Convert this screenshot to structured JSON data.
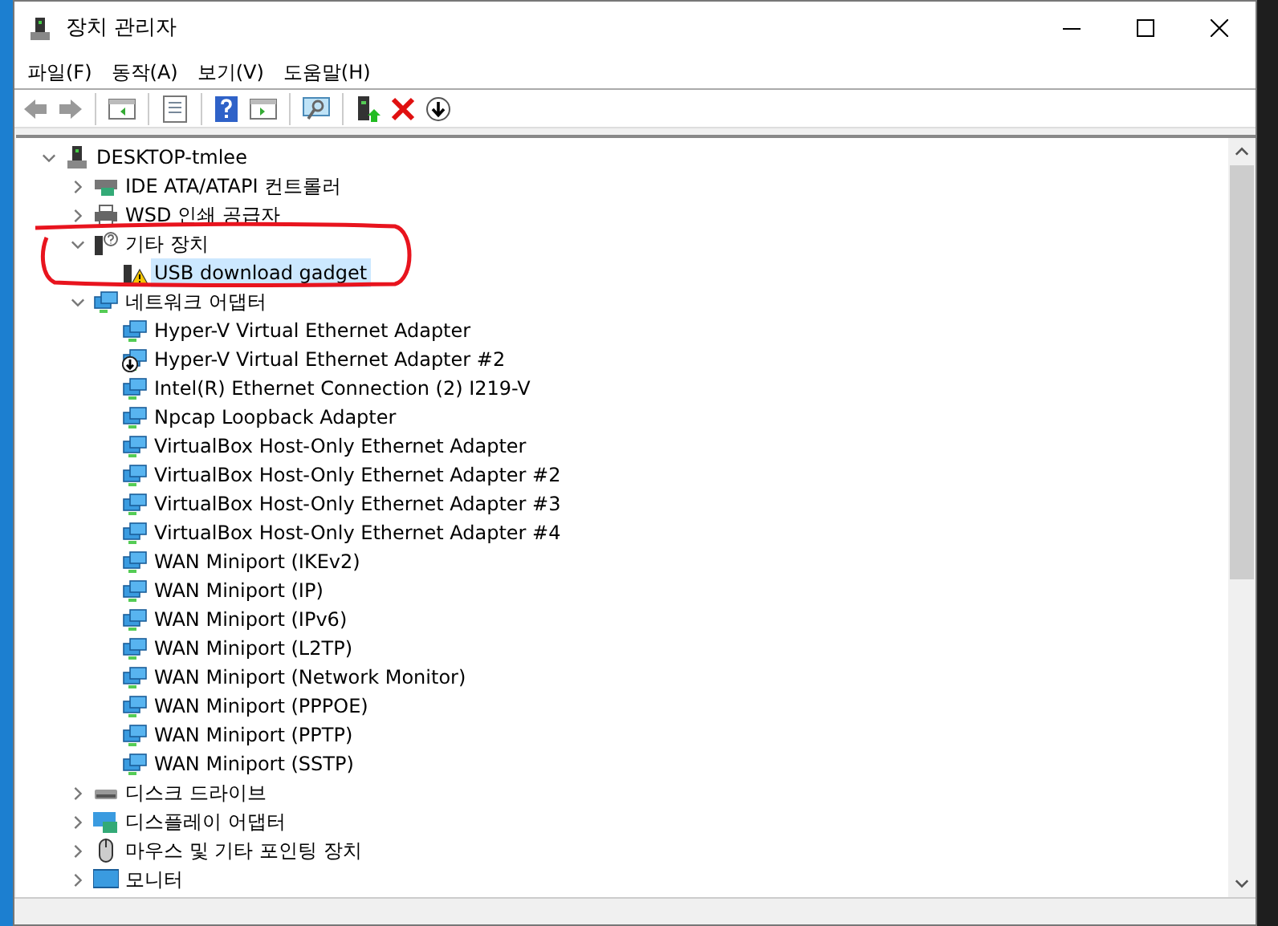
{
  "window": {
    "title": "장치 관리자"
  },
  "menu": [
    {
      "label": "파일(F)"
    },
    {
      "label": "동작(A)"
    },
    {
      "label": "보기(V)"
    },
    {
      "label": "도움말(H)"
    }
  ],
  "toolbar": [
    {
      "kind": "back"
    },
    {
      "kind": "forward"
    },
    {
      "kind": "sep"
    },
    {
      "kind": "tree-pane"
    },
    {
      "kind": "sep"
    },
    {
      "kind": "properties"
    },
    {
      "kind": "sep"
    },
    {
      "kind": "help"
    },
    {
      "kind": "action-pane"
    },
    {
      "kind": "sep"
    },
    {
      "kind": "scan"
    },
    {
      "kind": "sep"
    },
    {
      "kind": "update"
    },
    {
      "kind": "uninstall"
    },
    {
      "kind": "disable"
    }
  ],
  "tree": [
    {
      "label": "DESKTOP-tmlee",
      "kind": "computer",
      "expanded": true,
      "selected": false,
      "children": [
        {
          "label": "IDE ATA/ATAPI 컨트롤러",
          "kind": "controller",
          "expanded": false,
          "selected": false
        },
        {
          "label": "WSD 인쇄 공급자",
          "kind": "printer",
          "expanded": false,
          "selected": false
        },
        {
          "label": "기타 장치",
          "kind": "unknown",
          "expanded": true,
          "selected": false,
          "children": [
            {
              "label": "USB download gadget",
              "kind": "warning",
              "selected": true
            }
          ]
        },
        {
          "label": "네트워크 어댑터",
          "kind": "network",
          "expanded": true,
          "selected": false,
          "children": [
            {
              "label": "Hyper-V Virtual Ethernet Adapter",
              "kind": "network",
              "disabled": false,
              "selected": false
            },
            {
              "label": "Hyper-V Virtual Ethernet Adapter #2",
              "kind": "network",
              "disabled": true,
              "selected": false
            },
            {
              "label": "Intel(R) Ethernet Connection (2) I219-V",
              "kind": "network",
              "disabled": false,
              "selected": false
            },
            {
              "label": "Npcap Loopback Adapter",
              "kind": "network",
              "disabled": false,
              "selected": false
            },
            {
              "label": "VirtualBox Host-Only Ethernet Adapter",
              "kind": "network",
              "disabled": false,
              "selected": false
            },
            {
              "label": "VirtualBox Host-Only Ethernet Adapter #2",
              "kind": "network",
              "disabled": false,
              "selected": false
            },
            {
              "label": "VirtualBox Host-Only Ethernet Adapter #3",
              "kind": "network",
              "disabled": false,
              "selected": false
            },
            {
              "label": "VirtualBox Host-Only Ethernet Adapter #4",
              "kind": "network",
              "disabled": false,
              "selected": false
            },
            {
              "label": "WAN Miniport (IKEv2)",
              "kind": "network",
              "disabled": false,
              "selected": false
            },
            {
              "label": "WAN Miniport (IP)",
              "kind": "network",
              "disabled": false,
              "selected": false
            },
            {
              "label": "WAN Miniport (IPv6)",
              "kind": "network",
              "disabled": false,
              "selected": false
            },
            {
              "label": "WAN Miniport (L2TP)",
              "kind": "network",
              "disabled": false,
              "selected": false
            },
            {
              "label": "WAN Miniport (Network Monitor)",
              "kind": "network",
              "disabled": false,
              "selected": false
            },
            {
              "label": "WAN Miniport (PPPOE)",
              "kind": "network",
              "disabled": false,
              "selected": false
            },
            {
              "label": "WAN Miniport (PPTP)",
              "kind": "network",
              "disabled": false,
              "selected": false
            },
            {
              "label": "WAN Miniport (SSTP)",
              "kind": "network",
              "disabled": false,
              "selected": false
            }
          ]
        },
        {
          "label": "디스크 드라이브",
          "kind": "disk",
          "expanded": false,
          "selected": false
        },
        {
          "label": "디스플레이 어댑터",
          "kind": "display",
          "expanded": false,
          "selected": false
        },
        {
          "label": "마우스 및 기타 포인팅 장치",
          "kind": "mouse",
          "expanded": false,
          "selected": false
        },
        {
          "label": "모니터",
          "kind": "monitor",
          "expanded": false,
          "selected": false
        }
      ]
    }
  ]
}
